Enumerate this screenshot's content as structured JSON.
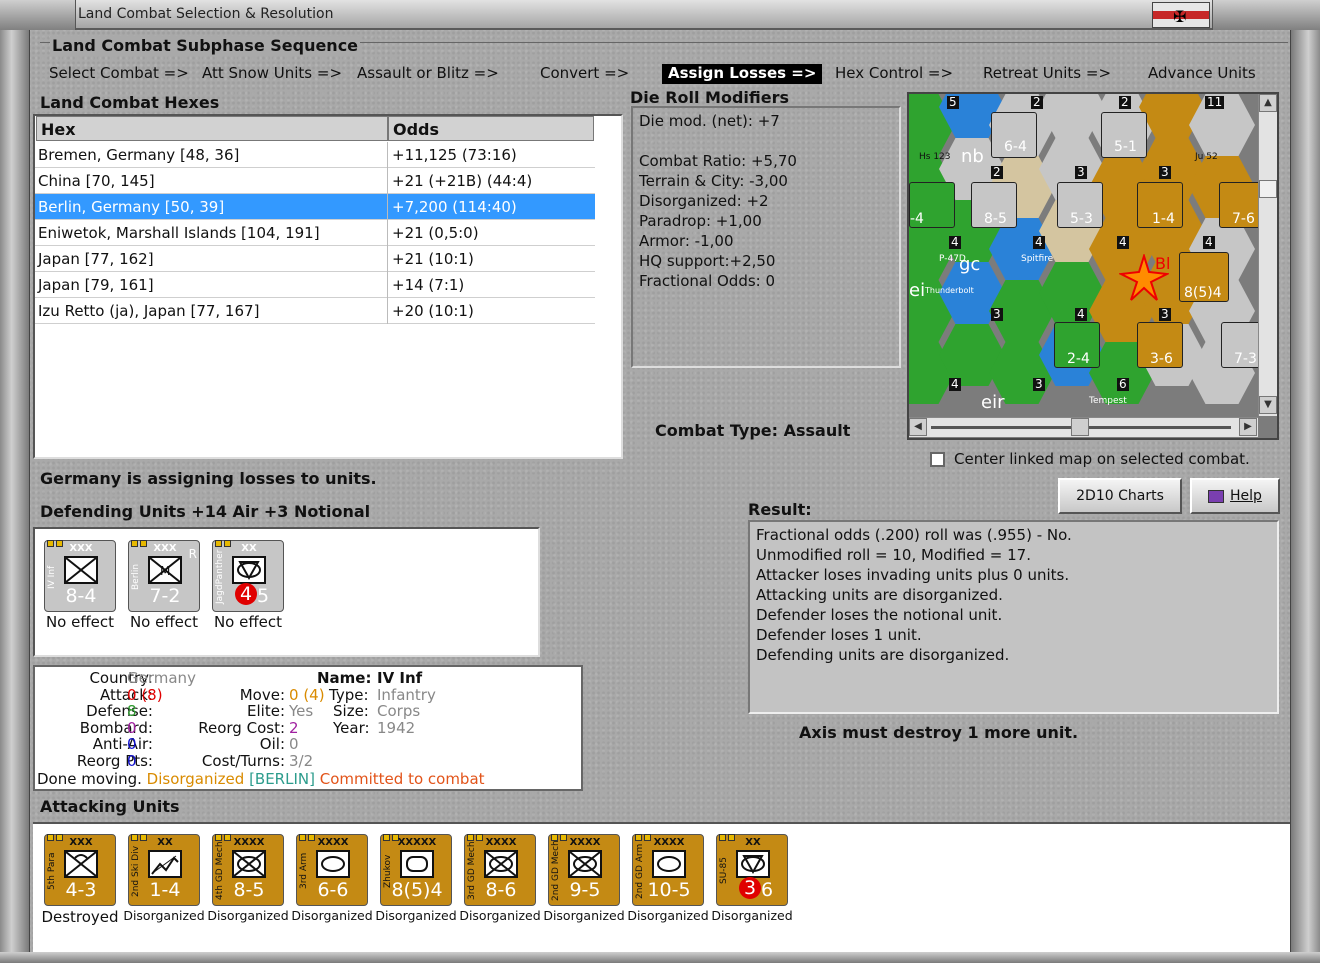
{
  "window": {
    "title": "Land Combat Selection & Resolution"
  },
  "sequence": {
    "title": "Land Combat Subphase Sequence",
    "steps": [
      "Select Combat =>",
      "Att Snow Units =>",
      "Assault or Blitz =>",
      "Convert =>",
      "Assign Losses =>",
      "Hex Control =>",
      "Retreat Units =>",
      "Advance Units"
    ],
    "active_index": 4
  },
  "hexes": {
    "title": "Land Combat Hexes",
    "columns": [
      "Hex",
      "Odds"
    ],
    "rows": [
      {
        "hex": "Bremen, Germany [48, 36]",
        "odds": "+11,125 (73:16)"
      },
      {
        "hex": "China [70, 145]",
        "odds": "+21 (+21B) (44:4)"
      },
      {
        "hex": "Berlin, Germany [50, 39]",
        "odds": "+7,200 (114:40)",
        "selected": true
      },
      {
        "hex": "Eniwetok, Marshall Islands [104, 191]",
        "odds": "+21 (0,5:0)"
      },
      {
        "hex": "Japan [77, 162]",
        "odds": "+21 (10:1)"
      },
      {
        "hex": "Japan [79, 161]",
        "odds": "+14 (7:1)"
      },
      {
        "hex": "Izu Retto (ja), Japan [77, 167]",
        "odds": "+20 (10:1)"
      }
    ]
  },
  "die_roll": {
    "title": "Die Roll Modifiers",
    "lines": [
      "Die mod. (net): +7",
      "",
      "Combat Ratio: +5,70",
      "Terrain & City: -3,00",
      "Disorganized: +2",
      "Paradrop: +1,00",
      "Armor: -1,00",
      "HQ support:+2,50",
      "Fractional Odds: 0"
    ]
  },
  "combat_type": {
    "label": "Combat Type:",
    "value": "Assault"
  },
  "center_map": {
    "label": "Center linked map on selected combat.",
    "checked": false
  },
  "status_line": "Germany is assigning losses to units.",
  "defending": {
    "title": "Defending Units +14 Air +3 Notional",
    "units": [
      {
        "size": "XXX",
        "name": "IV Inf",
        "strength": "8-4",
        "red": "",
        "status": "No effect",
        "type": "inf"
      },
      {
        "size": "XXX",
        "name": "Berlin",
        "strength": "7-2",
        "red": "",
        "status": "No effect",
        "type": "mtn",
        "corner": "R"
      },
      {
        "size": "XX",
        "name": "JagdPanther",
        "strength": "5",
        "red": "4",
        "status": "No effect",
        "type": "td"
      }
    ]
  },
  "buttons": {
    "charts": "2D10 Charts",
    "help": "Help"
  },
  "result": {
    "title": "Result:",
    "lines": [
      "Fractional odds (.200) roll was (.955)  - No.",
      "Unmodified roll = 10, Modified = 17.",
      "Attacker loses invading units plus 0 units.",
      "Attacking units are disorganized.",
      "Defender loses the notional unit.",
      "Defender loses 1 unit.",
      "Defending units are disorganized."
    ],
    "footer": "Axis must destroy 1 more unit."
  },
  "unit_info": {
    "country_k": "Country:",
    "country_v": "Germany",
    "attack_k": "Attack:",
    "attack_v": "0",
    "attack_v2": "(8)",
    "defense_k": "Defense:",
    "defense_v": "8",
    "bombard_k": "Bombard:",
    "bombard_v": "0",
    "antiair_k": "Anti-Air:",
    "antiair_v": "0",
    "reorg_k": "Reorg Pts:",
    "reorg_v": "0",
    "move_k": "Move:",
    "move_v": "0",
    "move_v2": "(4)",
    "elite_k": "Elite:",
    "elite_v": "Yes",
    "reorgcost_k": "Reorg Cost:",
    "reorgcost_v": "2",
    "oil_k": "Oil:",
    "oil_v": "0",
    "cost_k": "Cost/Turns:",
    "cost_v": "3/2",
    "name_k": "Name:",
    "name_v": "IV Inf",
    "type_k": "Type:",
    "type_v": "Infantry",
    "size_k": "Size:",
    "size_v": "Corps",
    "year_k": "Year:",
    "year_v": "1942",
    "done_k": "Done moving.",
    "done_v1": "Disorganized",
    "done_v2": "[BERLIN]",
    "done_v3": "Committed to combat"
  },
  "attacking": {
    "title": "Attacking Units",
    "units": [
      {
        "size": "XXX",
        "name": "5th Para",
        "strength": "4-3",
        "status": "Destroyed",
        "type": "para"
      },
      {
        "size": "XX",
        "name": "2nd Ski Div",
        "strength": "1-4",
        "status": "Disorganized",
        "type": "ski"
      },
      {
        "size": "XXXX",
        "name": "4th GD Mech",
        "strength": "8-5",
        "status": "Disorganized",
        "type": "mech"
      },
      {
        "size": "XXXX",
        "name": "3rd Arm",
        "strength": "6-6",
        "status": "Disorganized",
        "type": "arm"
      },
      {
        "size": "XXXXX",
        "name": "Zhukov",
        "strength": "8(5)4",
        "status": "Disorganized",
        "type": "hq"
      },
      {
        "size": "XXXX",
        "name": "3rd GD Mech",
        "strength": "8-6",
        "status": "Disorganized",
        "type": "mech"
      },
      {
        "size": "XXXX",
        "name": "2nd GD Mech",
        "strength": "9-5",
        "status": "Disorganized",
        "type": "mech"
      },
      {
        "size": "XXXX",
        "name": "2nd GD Arm",
        "strength": "10-5",
        "status": "Disorganized",
        "type": "arm"
      },
      {
        "size": "XX",
        "name": "SU-85",
        "strength": "6",
        "red": "3",
        "status": "Disorganized",
        "type": "td"
      }
    ]
  },
  "map": {
    "hex_labels": [
      "6-4",
      "5-1",
      "8-5",
      "5-3",
      "1-4",
      "7-6",
      "8(5)4",
      "2-4",
      "3-6",
      "7-3",
      "-4"
    ],
    "air_labels": [
      "Hs 123",
      "Ju 52",
      "P-47D",
      "Thunderbolt",
      "Spitfire",
      "Tempest"
    ],
    "place_labels": [
      "nb",
      "gc",
      "ei",
      "Bl",
      "eir"
    ]
  },
  "colors": {
    "active_step": "#000000",
    "selected_row": "#3399ff",
    "allied_green": "#2fa32f",
    "soviet_orange": "#c48a14",
    "allied_blue": "#2a82d8",
    "german_grey": "#c6c6c6"
  }
}
